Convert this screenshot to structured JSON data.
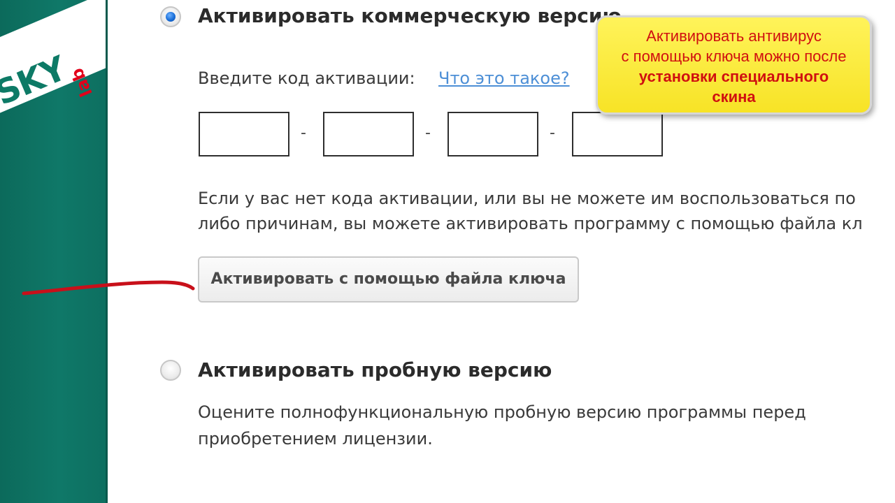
{
  "sidebar": {
    "logo_text": "SKY",
    "logo_sub": "lab"
  },
  "commercial": {
    "title": "Активировать коммерческую версию",
    "code_label": "Введите код активации:",
    "help_link": "Что это такое?",
    "code_fields": [
      "",
      "",
      "",
      ""
    ],
    "separator": "-",
    "info_line_1": "Если у вас нет кода активации, или вы не можете им воспользоваться по",
    "info_line_2": "либо причинам, вы можете активировать программу с помощью файла кл",
    "keyfile_button": "Активировать с помощью файла ключа",
    "selected": true
  },
  "trial": {
    "title": "Активировать пробную версию",
    "line_1": "Оцените полнофункциональную пробную версию программы перед",
    "line_2": "приобретением лицензии.",
    "selected": false
  },
  "callout": {
    "line_1": "Активировать антивирус",
    "line_2": "с помощью ключа можно после",
    "line_3": "установки специального",
    "line_4": "скина"
  },
  "colors": {
    "brand_green": "#0f7868",
    "callout_yellow": "#f7e326",
    "callout_text": "#d01010",
    "link_blue": "#4d8fd6",
    "annotation_red": "#c8101a"
  }
}
